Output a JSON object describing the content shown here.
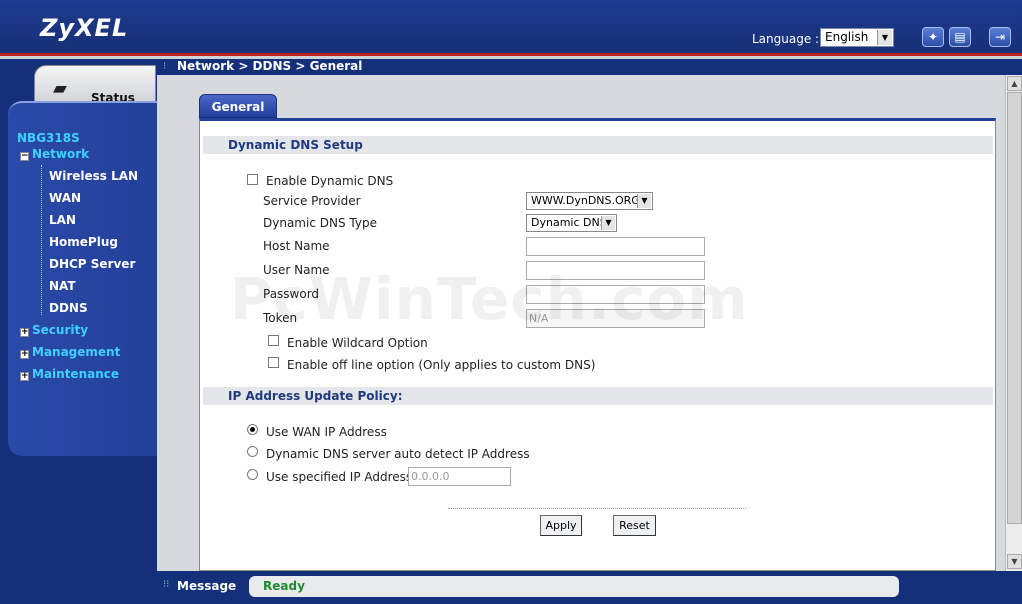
{
  "header": {
    "logo": "ZyXEL",
    "language_label": "Language :",
    "language_value": "English",
    "icons": [
      "wizard-icon",
      "notes-icon",
      "logout-icon"
    ]
  },
  "sidebar": {
    "status_tab": "Status",
    "device_name": "NBG318S",
    "menu": [
      {
        "label": "Network",
        "expanded": true
      },
      {
        "label": "Wireless LAN"
      },
      {
        "label": "WAN"
      },
      {
        "label": "LAN"
      },
      {
        "label": "HomePlug"
      },
      {
        "label": "DHCP Server"
      },
      {
        "label": "NAT"
      },
      {
        "label": "DDNS"
      },
      {
        "label": "Security",
        "expanded": false
      },
      {
        "label": "Management",
        "expanded": false
      },
      {
        "label": "Maintenance",
        "expanded": false
      }
    ]
  },
  "breadcrumb": "Network > DDNS > General",
  "tabs": [
    {
      "label": "General",
      "active": true
    }
  ],
  "ddns_setup": {
    "heading": "Dynamic DNS Setup",
    "enable_label": "Enable Dynamic DNS",
    "enable_checked": false,
    "service_provider_label": "Service Provider",
    "service_provider_value": "WWW.DynDNS.ORG",
    "dns_type_label": "Dynamic DNS Type",
    "dns_type_value": "Dynamic DNS",
    "host_name_label": "Host Name",
    "host_name_value": "",
    "user_name_label": "User Name",
    "user_name_value": "",
    "password_label": "Password",
    "password_value": "",
    "token_label": "Token",
    "token_value": "N/A",
    "wildcard_label": "Enable Wildcard Option",
    "offline_label": "Enable off line option (Only applies to custom DNS)"
  },
  "ip_policy": {
    "heading": "IP Address Update Policy:",
    "options": [
      {
        "label": "Use WAN IP Address",
        "selected": true
      },
      {
        "label": "Dynamic DNS server auto detect IP Address",
        "selected": false
      },
      {
        "label": "Use specified IP Address",
        "selected": false
      }
    ],
    "specified_ip_value": "0.0.0.0"
  },
  "buttons": {
    "apply": "Apply",
    "reset": "Reset"
  },
  "status_bar": {
    "label": "Message",
    "message": "Ready"
  },
  "watermark": "PcWinTech.com"
}
